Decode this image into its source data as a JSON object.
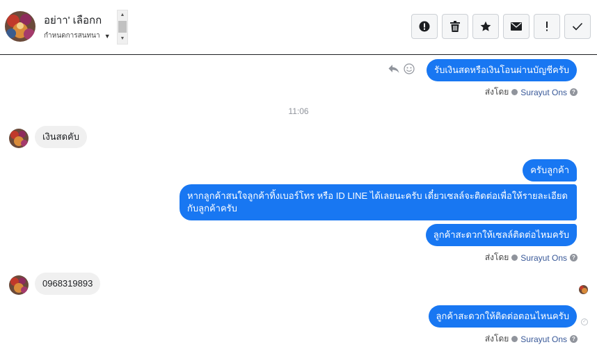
{
  "header": {
    "contact_name": "อย่าา' เลือกก",
    "label_select": "กำหนดการสนทนา",
    "actions": [
      {
        "name": "spam",
        "icon": "alert-circle-icon"
      },
      {
        "name": "delete",
        "icon": "trash-icon"
      },
      {
        "name": "star",
        "icon": "star-icon"
      },
      {
        "name": "mark-unread",
        "icon": "envelope-icon"
      },
      {
        "name": "important",
        "icon": "exclamation-icon"
      },
      {
        "name": "done",
        "icon": "check-icon"
      }
    ]
  },
  "messages": {
    "m1": "รับเงินสดหรือเงินโอนผ่านบัญชีครับ",
    "time": "11:06",
    "m2": "เงินสดคับ",
    "m3": "ครับลูกค้า",
    "m4": "หากลูกค้าสนใจลูกค้าทิ้งเบอร์โทร หรือ ID LINE ได้เลยนะครับ เดี๋ยวเซลล์จะติดต่อเพื่อให้รายละเอียดกับลูกค้าครับ",
    "m5": "ลูกค้าสะดวกให้เซลล์ติดต่อไหมครับ",
    "m6": "0968319893",
    "m7": "ลูกค้าสะดวกให้ติดต่อตอนไหนครับ"
  },
  "sent_by": {
    "prefix": "ส่งโดย",
    "agent": "Surayut Ons"
  },
  "colors": {
    "outgoing": "#1877f2",
    "incoming": "#f0f0f0"
  }
}
